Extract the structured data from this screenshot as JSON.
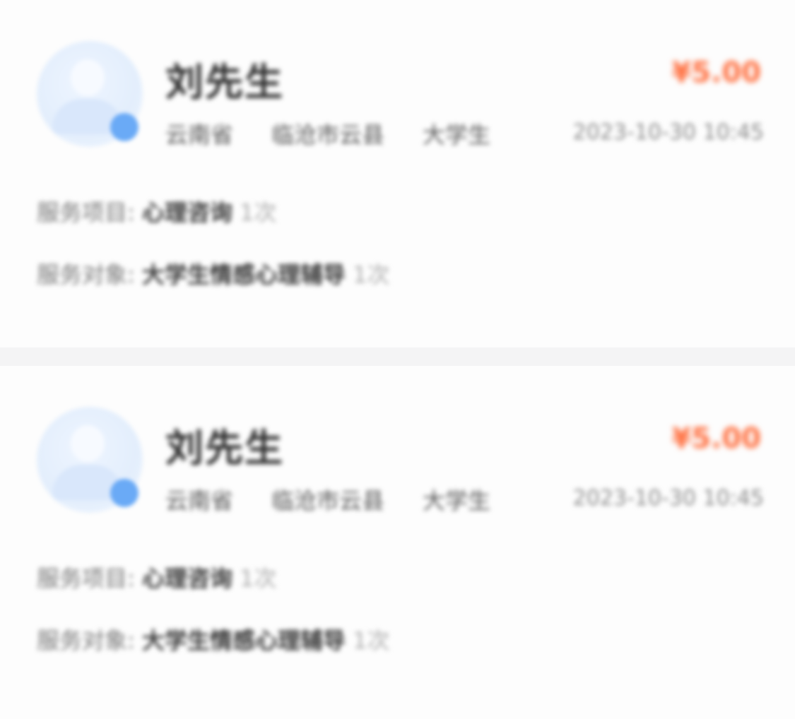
{
  "cards": [
    {
      "name": "刘先生",
      "tags": [
        "云南省",
        "临沧市云县",
        "大学生"
      ],
      "price": "¥5.00",
      "time": "2023-10-30 10:45",
      "line1": {
        "label": "服务项目:",
        "value": "心理咨询",
        "suffix": "1次"
      },
      "line2": {
        "label": "服务对象:",
        "value": "大学生情感心理辅导",
        "suffix": "1次"
      }
    },
    {
      "name": "刘先生",
      "tags": [
        "云南省",
        "临沧市云县",
        "大学生"
      ],
      "price": "¥5.00",
      "time": "2023-10-30 10:45",
      "line1": {
        "label": "服务项目:",
        "value": "心理咨询",
        "suffix": "1次"
      },
      "line2": {
        "label": "服务对象:",
        "value": "大学生情感心理辅导",
        "suffix": "1次"
      }
    }
  ],
  "colors": {
    "accent": "#ff6f3f",
    "avatar_badge": "#6aaaf6"
  }
}
